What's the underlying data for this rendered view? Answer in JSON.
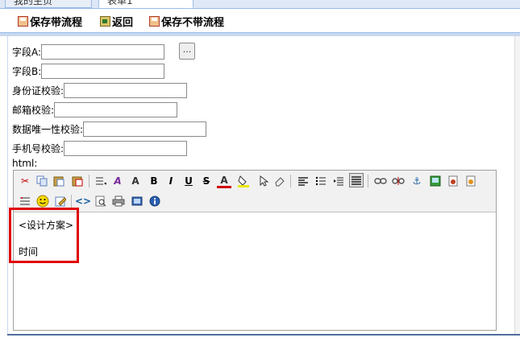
{
  "tabs": [
    {
      "label": "我的主页"
    },
    {
      "label": "表单1"
    }
  ],
  "toolbar": {
    "save_with_flow": "保存带流程",
    "back": "返回",
    "save_without_flow": "保存不带流程"
  },
  "form": {
    "field_a": {
      "label": "字段A:",
      "value": ""
    },
    "pick_button": "...",
    "field_b": {
      "label": "字段B:",
      "value": ""
    },
    "id_check": {
      "label": "身份证校验:",
      "value": ""
    },
    "email_check": {
      "label": "邮箱校验:",
      "value": ""
    },
    "unique_check": {
      "label": "数据唯一性校验:",
      "value": ""
    },
    "phone_check": {
      "label": "手机号校验:",
      "value": ""
    },
    "html_label": "html:"
  },
  "editor": {
    "content_lines": [
      "<设计方案>",
      "时间"
    ],
    "toolbar_row1": [
      "cut-icon",
      "copy-icon",
      "paste-icon",
      "paste-text-icon",
      "paragraph-format-icon",
      "font-family-icon",
      "font-size-icon",
      "bold-icon",
      "italic-icon",
      "underline-icon",
      "strikethrough-icon",
      "font-color-icon",
      "background-color-icon",
      "select-icon",
      "eraser-icon",
      "align-left-icon",
      "unordered-list-icon",
      "indent-icon",
      "justify-icon",
      "link-icon",
      "unlink-icon",
      "anchor-icon",
      "image-icon",
      "flash-icon",
      "media-icon"
    ],
    "toolbar_row2": [
      "table-icon",
      "emoticon-icon",
      "edit-icon",
      "source-code-icon",
      "preview-icon",
      "print-icon",
      "fullscreen-icon",
      "about-icon"
    ]
  },
  "colors": {
    "highlight": "#e00000",
    "accent": "#99bbe8"
  }
}
